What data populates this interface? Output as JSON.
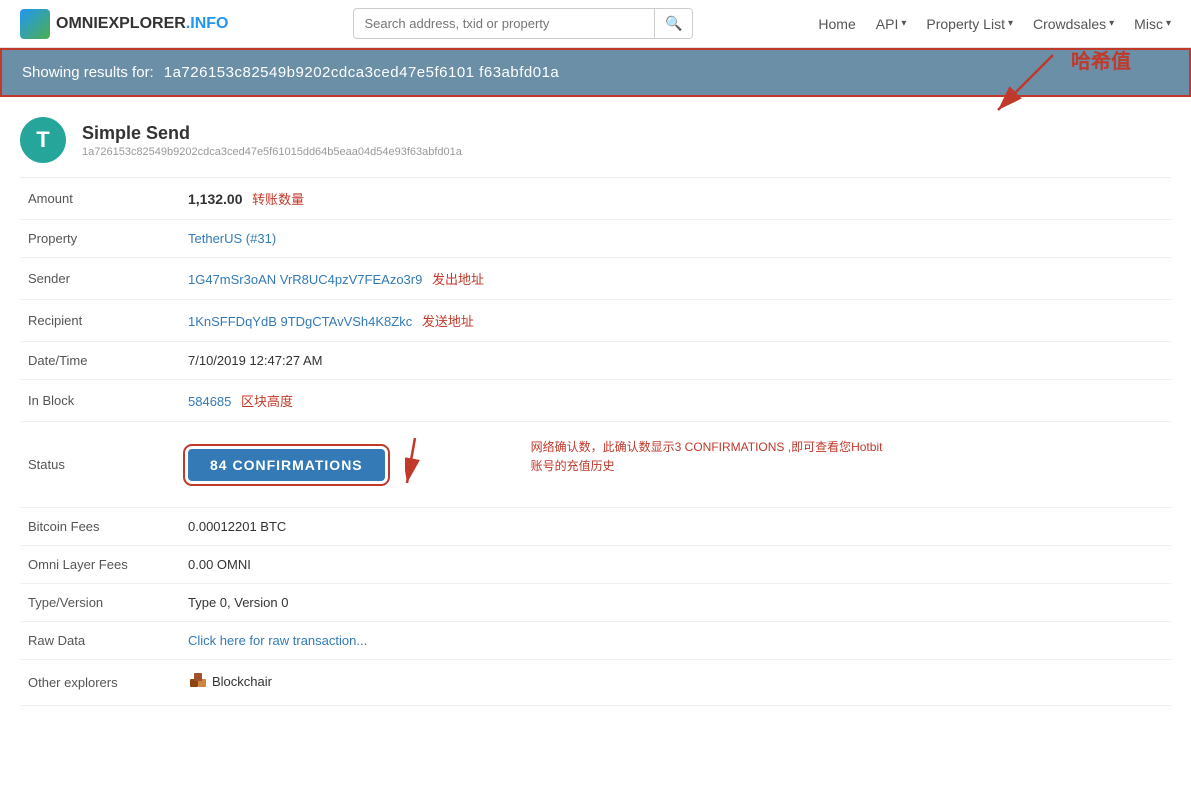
{
  "brand": {
    "name_part1": "OMNIEXPLORER",
    "name_part2": ".INFO"
  },
  "search": {
    "placeholder": "Search address, txid or property"
  },
  "nav": {
    "home": "Home",
    "api": "API",
    "api_caret": "▾",
    "property_list": "Property List",
    "property_list_caret": "▾",
    "crowdsales": "Crowdsales",
    "crowdsales_caret": "▾",
    "misc": "Misc",
    "misc_caret": "▾"
  },
  "result_bar": {
    "label": "Showing results for:",
    "hash": "1a726153c82549b9202cdca3ced47e5f6101                                         f63abfd01a"
  },
  "annotation": {
    "hash_label": "哈希值"
  },
  "transaction": {
    "type": "Simple Send",
    "full_hash": "1a726153c82549b9202cdca3ced47e5f61015dd64b5eaa04d54e93f63abfd01a",
    "icon_letter": "T"
  },
  "details": {
    "amount_label": "Amount",
    "amount_value": "1,132.00",
    "amount_annotation": "转账数量",
    "property_label": "Property",
    "property_value": "TetherUS (#31)",
    "sender_label": "Sender",
    "sender_value": "1G47mSr3oAN             VrR8UC4pzV7FEAzo3r9",
    "sender_annotation": "发出地址",
    "recipient_label": "Recipient",
    "recipient_value": "1KnSFFDqYdB             9TDgCTAvVSh4K8Zkc",
    "recipient_annotation": "发送地址",
    "datetime_label": "Date/Time",
    "datetime_value": "7/10/2019 12:47:27 AM",
    "inblock_label": "In Block",
    "inblock_value": "584685",
    "inblock_annotation": "区块高度",
    "status_label": "Status",
    "status_value": "84 CONFIRMATIONS",
    "btcfees_label": "Bitcoin Fees",
    "btcfees_value": "0.00012201 BTC",
    "omnifees_label": "Omni Layer Fees",
    "omnifees_value": "0.00 OMNI",
    "typeversion_label": "Type/Version",
    "typeversion_value": "Type 0, Version 0",
    "rawdata_label": "Raw Data",
    "rawdata_value": "Click here for raw transaction...",
    "explorers_label": "Other explorers",
    "explorers_value": "Blockchair"
  },
  "confirm_annotation": {
    "text_line1": "网络确认数，此确认数显示3 CONFIRMATIONS ,即可查看您Hotbit",
    "text_line2": "账号的充值历史"
  }
}
